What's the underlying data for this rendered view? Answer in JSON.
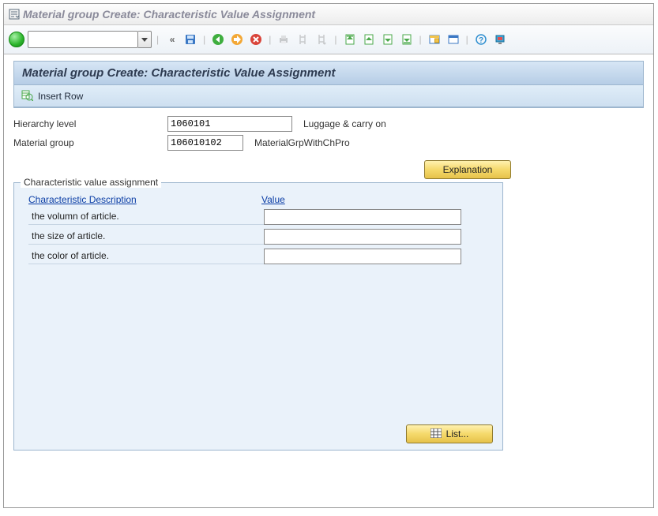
{
  "window": {
    "title": "Material group  Create: Characteristic Value Assignment"
  },
  "panel": {
    "title": "Material group  Create: Characteristic Value Assignment",
    "insert_row": "Insert Row"
  },
  "header": {
    "hierarchy_label": "Hierarchy level",
    "hierarchy_value": "1060101",
    "hierarchy_desc": "Luggage & carry on",
    "matgrp_label": "Material group",
    "matgrp_value": "106010102",
    "matgrp_desc": "MaterialGrpWithChPro"
  },
  "buttons": {
    "explanation": "Explanation",
    "list": "List..."
  },
  "char_box": {
    "title": "Characteristic value assignment",
    "col_desc": "Characteristic Description",
    "col_value": "Value",
    "rows": [
      {
        "label": "the volumn of article.",
        "value": ""
      },
      {
        "label": "the size of article.",
        "value": ""
      },
      {
        "label": "the color of article.",
        "value": ""
      }
    ]
  }
}
